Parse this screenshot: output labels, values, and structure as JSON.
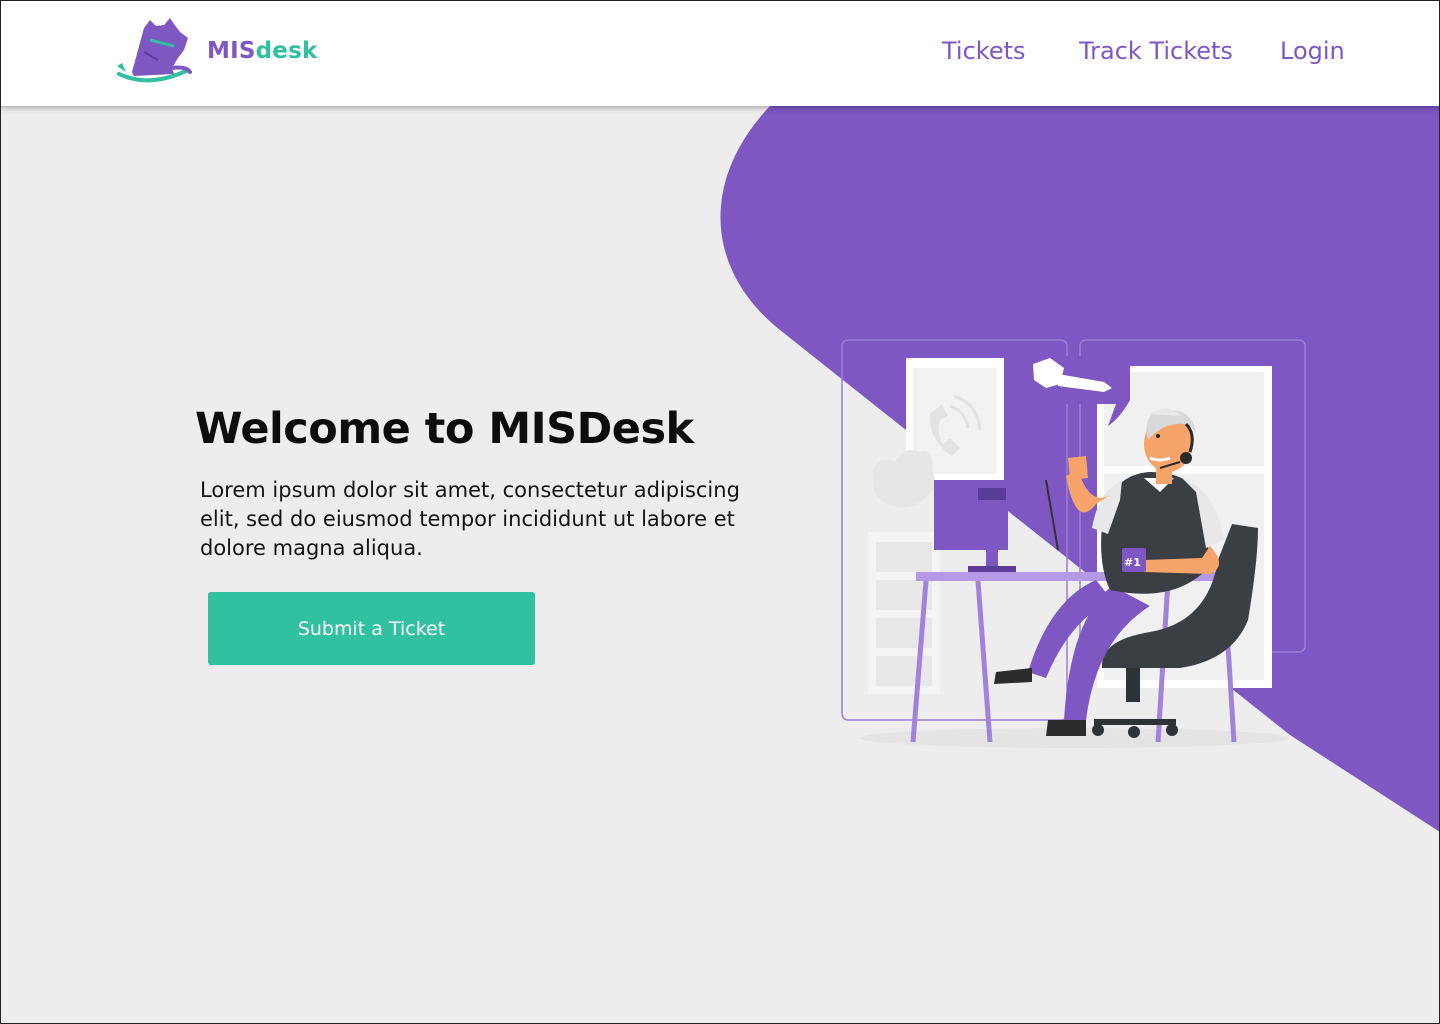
{
  "brand": {
    "name_part1": "MIS",
    "name_part2": "desk",
    "logo_icon": "cat-logo-icon"
  },
  "nav": [
    {
      "label": "Tickets"
    },
    {
      "label": "Track Tickets"
    },
    {
      "label": "Login"
    }
  ],
  "hero": {
    "title": "Welcome to MISDesk",
    "description": "Lorem ipsum dolor sit amet, consectetur adipiscing elit, sed do eiusmod tempor incididunt ut labore et dolore magna aliqua.",
    "cta_label": "Submit a Ticket"
  },
  "illustration": {
    "mug_label": "#1",
    "icon": "customer-support-illustration"
  },
  "colors": {
    "primary": "#7e57c2",
    "accent": "#31c1a0",
    "background": "#ededed",
    "header": "#ffffff"
  }
}
